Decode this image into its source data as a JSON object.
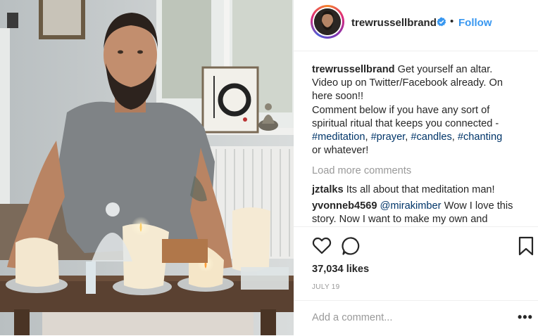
{
  "post": {
    "username": "trewrussellbrand",
    "follow_label": "Follow",
    "dot": "•",
    "caption": {
      "line1": "Get yourself an altar.",
      "line2": "Video up on Twitter/Facebook already. On",
      "line3": "here soon!!",
      "line4": "Comment below if you have any sort of",
      "line5": "spiritual ritual that keeps you connected -",
      "tags": [
        "#meditation",
        "#prayer",
        "#candles",
        "#chanting"
      ],
      "line7": "or whatever!"
    },
    "load_more": "Load more comments",
    "comments": [
      {
        "user": "jztalks",
        "text": "Its all about that meditation man!"
      },
      {
        "user": "yvonneb4569",
        "mention": "@mirakimber",
        "text_line1": " Wow I love this",
        "text_line2": "story. Now I want to make my own and"
      }
    ],
    "likes": "37,034 likes",
    "date": "JULY 19",
    "add_comment_placeholder": "Add a comment...",
    "more_label": "•••"
  },
  "icons": {
    "like": "heart-icon",
    "comment": "comment-icon",
    "save": "bookmark-icon",
    "verified": "verified-badge-icon"
  },
  "colors": {
    "link": "#3897f0",
    "hashtag": "#003569",
    "muted": "#999999",
    "text": "#262626"
  }
}
